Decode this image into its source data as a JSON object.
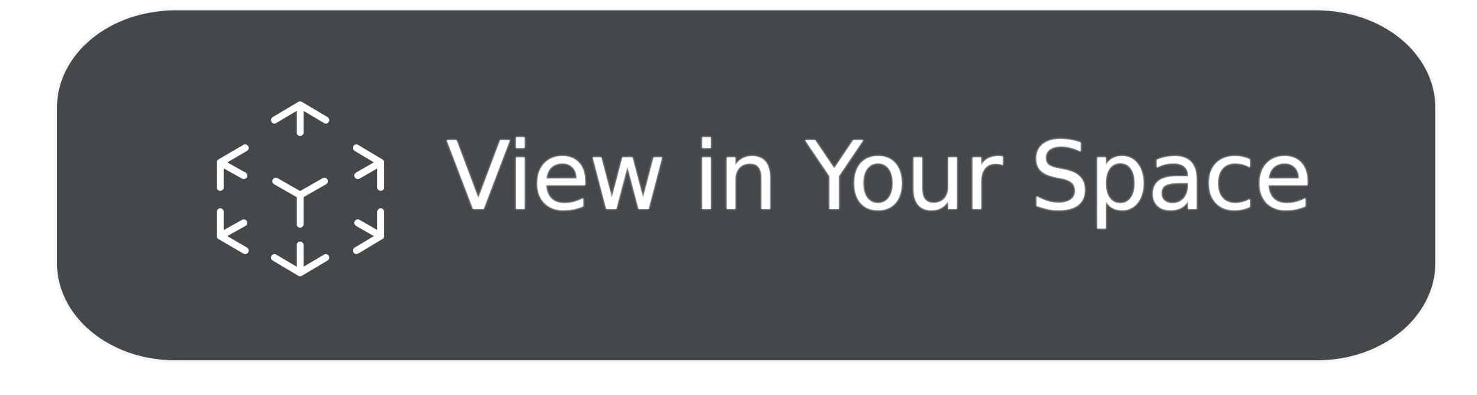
{
  "button": {
    "label": "View in Your Space",
    "icon": "ar-cube-icon"
  },
  "colors": {
    "background": "#ffffff",
    "button_fill": "#45484b",
    "label": "#ffffff",
    "icon_stroke": "#ffffff"
  }
}
